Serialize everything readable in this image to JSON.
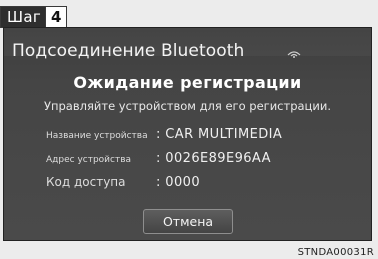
{
  "step": {
    "label": "Шаг",
    "number": "4"
  },
  "screen": {
    "title": "Подсоединение Bluetooth",
    "subtitle": "Ожидание регистрации",
    "instruction": "Управляйте устройством для его регистрации.",
    "device_name": {
      "label": "Название устройства",
      "value": ": CAR MULTIMEDIA"
    },
    "device_address": {
      "label": "Адрес устройства",
      "value": ": 0026E89E96AA"
    },
    "passkey": {
      "label": "Код доступа",
      "value": ": 0000"
    },
    "cancel_label": "Отмена",
    "signal_icon": "bluetooth-signal-icon"
  },
  "reference_code": "STNDA00031R",
  "colors": {
    "screen_background": "#454545",
    "text": "#ffffff",
    "page_background": "#ececec"
  }
}
